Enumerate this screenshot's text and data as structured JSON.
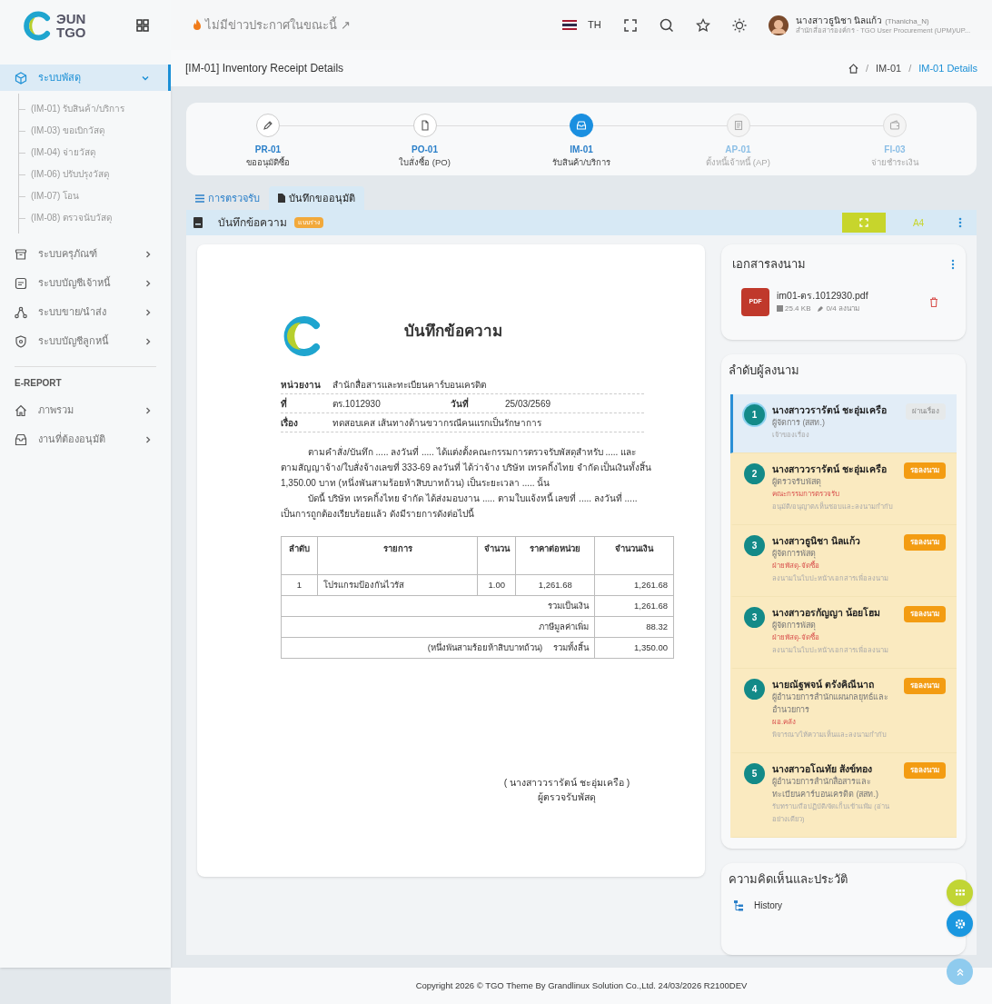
{
  "brand": {
    "line1": "ЭUN",
    "line2": "TGO"
  },
  "sidebar": {
    "items": [
      {
        "label": "ระบบพัสดุ",
        "expanded": true,
        "selected": true,
        "children": [
          {
            "label": "(IM-01) รับสินค้า/บริการ"
          },
          {
            "label": "(IM-03) ขอเบิกวัสดุ"
          },
          {
            "label": "(IM-04) จ่ายวัสดุ"
          },
          {
            "label": "(IM-06) ปรับปรุงวัสดุ"
          },
          {
            "label": "(IM-07) โอน"
          },
          {
            "label": "(IM-08) ตรวจนับวัสดุ"
          }
        ]
      },
      {
        "label": "ระบบครุภัณฑ์",
        "expanded": false,
        "selected": false
      },
      {
        "label": "ระบบบัญชีเจ้าหนี้",
        "expanded": false,
        "selected": false
      },
      {
        "label": "ระบบขาย/นำส่ง",
        "expanded": false,
        "selected": false
      },
      {
        "label": "ระบบบัญชีลูกหนี้",
        "expanded": false,
        "selected": false
      }
    ],
    "section": "E-REPORT",
    "report_items": [
      {
        "label": "ภาพรวม"
      },
      {
        "label": "งานที่ต้องอนุมัติ"
      }
    ]
  },
  "topbar": {
    "announcement": "ไม่มีข่าวประกาศในขณะนี้ ↗",
    "language": "TH",
    "user_name": "นางสาวธูนิชา นิลแก้ว",
    "user_handle": "(Thanicha_N)",
    "user_org": "สำนักสื่อสารองค์กร · TGO User Procurement (UPM)/UP..."
  },
  "page": {
    "title": "[IM-01] Inventory Receipt Details",
    "breadcrumb": [
      {
        "kind": "separator",
        "text": "/"
      },
      {
        "kind": "link",
        "text": "IM-01",
        "selected": false
      },
      {
        "kind": "separator",
        "text": "/"
      },
      {
        "kind": "link",
        "text": "IM-01 Details",
        "selected": true
      }
    ]
  },
  "steps": [
    {
      "code": "PR-01",
      "label": "ขออนุมัติซื้อ",
      "completed": true,
      "selected": false
    },
    {
      "code": "PO-01",
      "label": "ใบสั่งซื้อ (PO)",
      "completed": true,
      "selected": false
    },
    {
      "code": "IM-01",
      "label": "รับสินค้า/บริการ",
      "selected": true
    },
    {
      "code": "AP-01",
      "label": "ตั้งหนี้เจ้าหนี้ (AP)",
      "completed": false,
      "selected": false
    },
    {
      "code": "FI-03",
      "label": "จ่ายชำระเงิน",
      "completed": false,
      "selected": false
    }
  ],
  "tabs": [
    {
      "label": "การตรวจรับ",
      "selected": false
    },
    {
      "label": "บันทึกขออนุมัติ",
      "selected": true
    }
  ],
  "doc_toolbar": {
    "title": "บันทึกข้อความ",
    "badge": "แบบร่าง",
    "paper": "A4"
  },
  "memo": {
    "title": "บันทึกข้อความ",
    "fields": [
      {
        "label": "หน่วยงาน",
        "value": "สำนักสื่อสารและทะเบียนคาร์บอนเครดิต"
      },
      {
        "label": "ที่",
        "value": "ตร.1012930",
        "label2": "วันที่",
        "value2": "25/03/2569"
      },
      {
        "label": "เรื่อง",
        "value": "ทดสอบเคส เส้นทางด้านขวากรณีคนแรกเป็นรักษาการ"
      }
    ],
    "paragraphs": [
      "ตามคำสั่ง/บันทึก ..... ลงวันที่ ..... ได้แต่งตั้งคณะกรรมการตรวจรับพัสดุสำหรับ ..... และตามสัญญาจ้าง/ใบสั่งจ้างเลขที่ 333-69 ลงวันที่ ได้ว่าจ้าง บริษัท เทรคกิ้งไทย จำกัด เป็นเงินทั้งสิ้น 1,350.00 บาท (หนึ่งพันสามร้อยห้าสิบบาทถ้วน) เป็นระยะเวลา ..... นั้น",
      "บัดนี้ บริษัท เทรคกิ้งไทย จำกัด ได้ส่งมอบงาน ..... ตามใบแจ้งหนี้ เลขที่ ..... ลงวันที่ ..... เป็นการถูกต้องเรียบร้อยแล้ว ดังมีรายการดังต่อไปนี้"
    ],
    "table": {
      "columns": [
        "ลำดับ",
        "รายการ",
        "จำนวน",
        "ราคาต่อหน่วย",
        "จำนวนเงิน"
      ],
      "rows": [
        [
          "1",
          "โปรแกรมป้องกันไวรัส",
          "1.00",
          "1,261.68",
          "1,261.68"
        ]
      ],
      "summary": [
        {
          "label": "รวมเป็นเงิน",
          "value": "1,261.68"
        },
        {
          "label": "ภาษีมูลค่าเพิ่ม",
          "value": "88.32"
        },
        {
          "note": "(หนึ่งพันสามร้อยห้าสิบบาทถ้วน)",
          "label": "รวมทั้งสิ้น",
          "value": "1,350.00"
        }
      ]
    },
    "signature_name": "( นางสาววรารัตน์ ชะอุ่มเครือ )",
    "signature_title": "ผู้ตรวจรับพัสดุ"
  },
  "signed_docs": {
    "title": "เอกสารลงนาม",
    "file": {
      "type": "PDF",
      "name": "im01-ตร.1012930.pdf",
      "size": "25.4 KB",
      "signed": "0/4 ลงนาม"
    }
  },
  "signers": {
    "title": "ลำดับผู้ลงนาม",
    "items": [
      {
        "number": "1",
        "name": "นางสาววรารัตน์ ชะอุ่มเครือ",
        "role": "ผู้จัดการ (สสท.)",
        "note": "เจ้าของเรื่อง",
        "status": "ผ่านเรื่อง",
        "kind": "owner",
        "selected": true
      },
      {
        "number": "2",
        "name": "นางสาววรารัตน์ ชะอุ่มเครือ",
        "role": "ผู้ตรวจรับพัสดุ",
        "dept": "คณะกรรมการตรวจรับ",
        "note": "อนุมัติ/อนุญาต/เห็นชอบและลงนามกำกับ",
        "status": "รอลงนาม",
        "kind": "waiting",
        "selected": false
      },
      {
        "number": "3",
        "name": "นางสาวธูนิชา นิลแก้ว",
        "role": "ผู้จัดการพัสดุ",
        "dept": "ฝ่ายพัสดุ-จัดซื้อ",
        "note": "ลงนามในใบปะหน้า/เอกสารเพื่อลงนาม",
        "status": "รอลงนาม",
        "kind": "waiting",
        "selected": false
      },
      {
        "number": "3",
        "name": "นางสาวอรกัญญา น้อยโฮม",
        "role": "ผู้จัดการพัสดุ",
        "dept": "ฝ่ายพัสดุ-จัดซื้อ",
        "note": "ลงนามในใบปะหน้า/เอกสารเพื่อลงนาม",
        "status": "รอลงนาม",
        "kind": "waiting",
        "selected": false
      },
      {
        "number": "4",
        "name": "นายณัฐพจน์ ตรังคิณีนาถ",
        "role": "ผู้อำนวยการสำนักแผนกลยุทธ์และอำนวยการ",
        "dept": "ผอ.คลัง",
        "note": "พิจารณา/ให้ความเห็นและลงนามกำกับ",
        "status": "รอลงนาม",
        "kind": "waiting",
        "selected": false
      },
      {
        "number": "5",
        "name": "นางสาวอโณทัย สังข์ทอง",
        "role": "ผู้อำนวยการสำนักสื่อสารและทะเบียนคาร์บอนเครดิต (สสท.)",
        "note": "รับทราบ/ถือปฏิบัติ/จัดเก็บเข้าแฟ้ม (อ่านอย่างเดียว)",
        "status": "รอลงนาม",
        "kind": "waiting",
        "selected": false
      }
    ]
  },
  "comments": {
    "title": "ความคิดเห็นและประวัติ",
    "items": [
      "History"
    ]
  },
  "footer": "Copyright 2026 © TGO Theme By Grandlinux Solution Co.,Ltd. 24/03/2026 R2100DEV"
}
